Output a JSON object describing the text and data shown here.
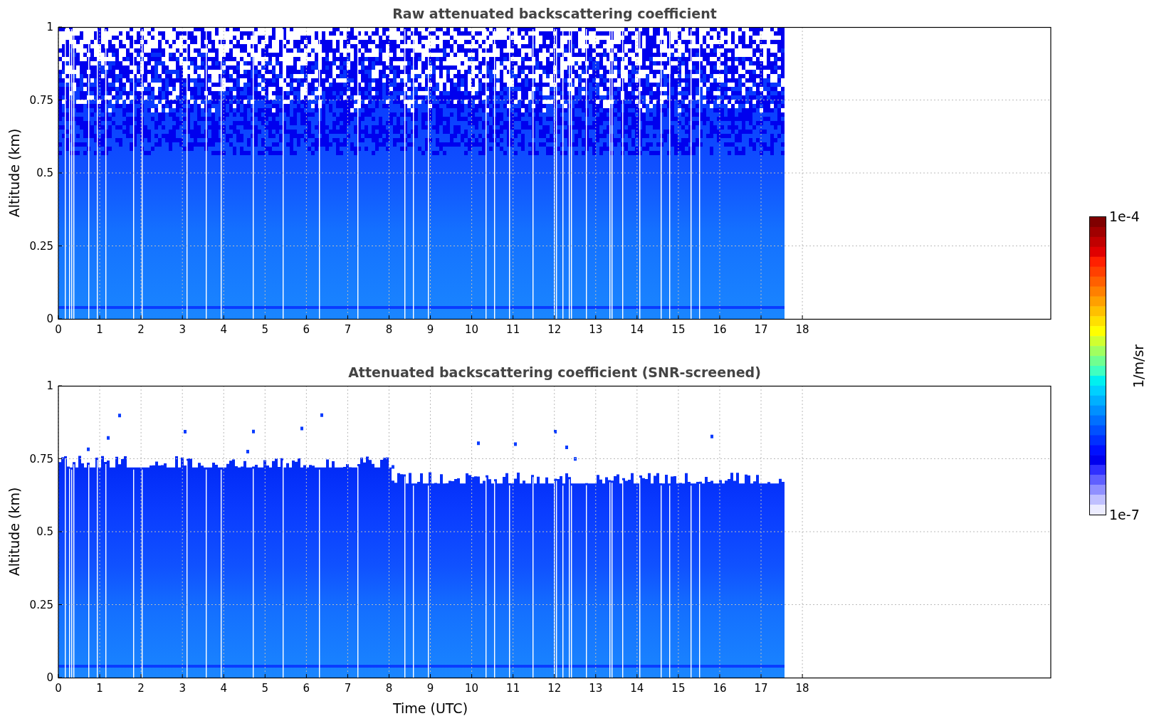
{
  "charts": [
    {
      "kind": "raw",
      "title": "Raw attenuated backscattering coefficient",
      "ylabel": "Altitude (km)",
      "yticks": [
        "1",
        "0.75",
        "0.5",
        "0.25",
        "0"
      ],
      "xticks": [
        "0",
        "1",
        "2",
        "3",
        "4",
        "5",
        "6",
        "7",
        "8",
        "9",
        "10",
        "11",
        "12",
        "13",
        "14",
        "15",
        "16",
        "17",
        "18"
      ]
    },
    {
      "kind": "screened",
      "title": "Attenuated backscattering coefficient (SNR-screened)",
      "ylabel": "Altitude (km)",
      "yticks": [
        "1",
        "0.75",
        "0.5",
        "0.25",
        "0"
      ],
      "xticks": [
        "0",
        "1",
        "2",
        "3",
        "4",
        "5",
        "6",
        "7",
        "8",
        "9",
        "10",
        "11",
        "12",
        "13",
        "14",
        "15",
        "16",
        "17",
        "18"
      ],
      "xlabel": "Time (UTC)"
    }
  ],
  "colorbar": {
    "label": "1/m/sr",
    "max_label": "1e-4",
    "min_label": "1e-7"
  }
}
